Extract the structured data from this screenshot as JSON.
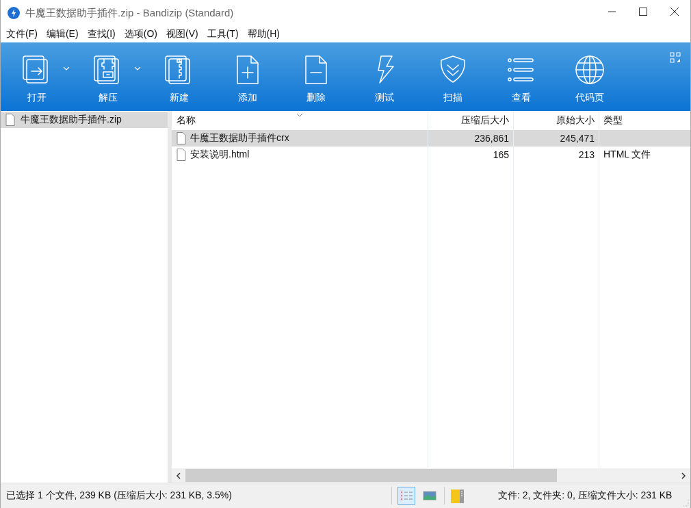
{
  "window": {
    "title": "牛魔王数据助手插件.zip - Bandizip (Standard)"
  },
  "menu": [
    "文件(F)",
    "编辑(E)",
    "查找(I)",
    "选项(O)",
    "视图(V)",
    "工具(T)",
    "帮助(H)"
  ],
  "toolbar": [
    {
      "kind": "open",
      "label": "打开",
      "dropdown": true
    },
    {
      "kind": "extract",
      "label": "解压",
      "dropdown": true
    },
    {
      "kind": "new",
      "label": "新建",
      "dropdown": false
    },
    {
      "kind": "add",
      "label": "添加",
      "dropdown": false
    },
    {
      "kind": "delete",
      "label": "删除",
      "dropdown": false
    },
    {
      "kind": "test",
      "label": "测试",
      "dropdown": false
    },
    {
      "kind": "scan",
      "label": "扫描",
      "dropdown": false
    },
    {
      "kind": "view",
      "label": "查看",
      "dropdown": false
    },
    {
      "kind": "codepage",
      "label": "代码页",
      "dropdown": false
    }
  ],
  "tree": [
    {
      "label": "牛魔王数据助手插件.zip",
      "selected": true
    }
  ],
  "table": {
    "columns": [
      "名称",
      "压缩后大小",
      "原始大小",
      "类型"
    ],
    "rows": [
      {
        "name": "牛魔王数据助手插件crx",
        "packed": "236,861",
        "size": "245,471",
        "selected": true
      },
      {
        "name": "安装说明.html",
        "packed": "165",
        "size": "213",
        "type": "HTML 文件",
        "selected": false
      }
    ]
  },
  "status_bar": {
    "selection": "已选择 1 个文件, 239 KB (压缩后大小: 231 KB, 3.5%)",
    "view_modes": [
      {
        "kind": "details",
        "selected": true
      },
      {
        "kind": "thumbnails",
        "selected": false
      }
    ],
    "summary": "文件: 2, 文件夹: 0, 压缩文件大小: 231 KB"
  }
}
